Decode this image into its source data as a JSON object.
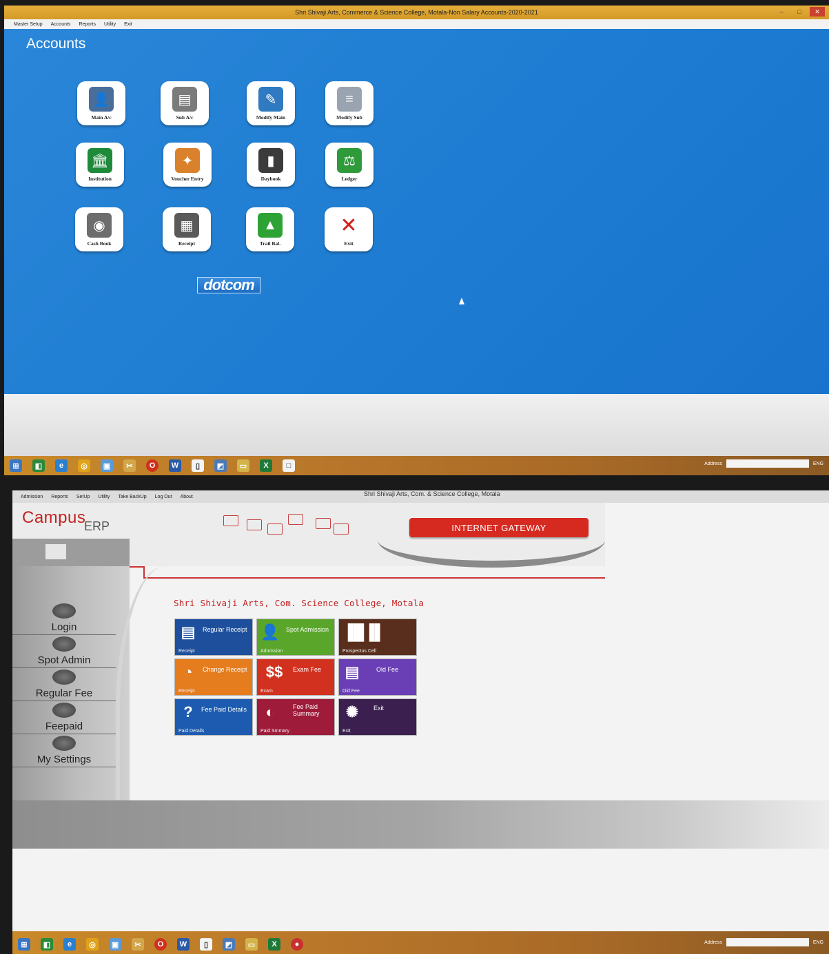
{
  "top": {
    "title": "Shri Shivaji Arts, Commerce & Science College, Motala-Non Salary Accounts-2020-2021",
    "menu": [
      "Master Setup",
      "Accounts",
      "Reports",
      "Utility",
      "Exit"
    ],
    "heading": "Accounts",
    "tiles": [
      {
        "label": "Main A/c",
        "icon": "person-folder-icon",
        "color": "#4a6e9a"
      },
      {
        "label": "Sub A/c",
        "icon": "document-stack-icon",
        "color": "#7b7b7b"
      },
      {
        "label": "Modify Main",
        "icon": "edit-document-icon",
        "color": "#2f7ac0"
      },
      {
        "label": "Modify Sub",
        "icon": "document-lines-icon",
        "color": "#9aa4b0"
      },
      {
        "label": "Institution",
        "icon": "building-icon",
        "color": "#1f8a3a"
      },
      {
        "label": "Voucher Entry",
        "icon": "cards-icon",
        "color": "#d9822b"
      },
      {
        "label": "Daybook",
        "icon": "book-icon",
        "color": "#3b3b3b"
      },
      {
        "label": "Ledger",
        "icon": "scale-icon",
        "color": "#2e9a3a"
      },
      {
        "label": "Cash Book",
        "icon": "coins-icon",
        "color": "#6d6d6d"
      },
      {
        "label": "Receipt",
        "icon": "receipt-icon",
        "color": "#5a5a5a"
      },
      {
        "label": "Trail Bal.",
        "icon": "chart-icon",
        "color": "#2fa236"
      },
      {
        "label": "Exit",
        "icon": "close-x-icon",
        "color": "#d0201a"
      }
    ],
    "brand": "dotcom"
  },
  "bottom": {
    "title": "Shri Shivaji Arts, Com. & Science College, Motala",
    "menu": [
      "Admission",
      "Reports",
      "SetUp",
      "Utility",
      "Take BackUp",
      "Log Out",
      "About"
    ],
    "logo_campus": "Campus",
    "logo_erp": "ERP",
    "gateway": "INTERNET GATEWAY",
    "sidebar": [
      {
        "label": "Login",
        "icon": "key-icon"
      },
      {
        "label": "Spot Admin",
        "icon": "person-card-icon"
      },
      {
        "label": "Regular Fee",
        "icon": "document-icon"
      },
      {
        "label": "Feepaid",
        "icon": "people-icon"
      },
      {
        "label": "My Settings",
        "icon": "tools-icon"
      }
    ],
    "college_name": "Shri Shivaji Arts, Com.  Science College, Motala",
    "tiles": [
      {
        "name": "Regular Receipt",
        "sub": "Receipt",
        "color": "#1d4f9c",
        "icon": "receipt-icon"
      },
      {
        "name": "Spot Admission",
        "sub": "Admission",
        "color": "#5aa62b",
        "icon": "person-icon"
      },
      {
        "name": "",
        "sub": "Prospectus Cell",
        "color": "#5a2e1c",
        "icon": "bar-chart-icon"
      },
      {
        "name": "Change Receipt",
        "sub": "Receipt",
        "color": "#e57c1e",
        "icon": "pie-chart-icon"
      },
      {
        "name": "Exam Fee",
        "sub": "Exam",
        "color": "#d2311f",
        "icon": "dollar-icon"
      },
      {
        "name": "Old Fee",
        "sub": "Old Fee",
        "color": "#6a3fb5",
        "icon": "document-icon"
      },
      {
        "name": "Fee Paid Details",
        "sub": "Paid Details",
        "color": "#1c5bb0",
        "icon": "question-icon"
      },
      {
        "name": "Fee Paid Summary",
        "sub": "Paid Smmary",
        "color": "#9e1b3a",
        "icon": "half-circle-icon"
      },
      {
        "name": "Exit",
        "sub": "Exit",
        "color": "#3a1f4f",
        "icon": "sun-gear-icon"
      }
    ]
  },
  "taskbar": {
    "address_label": "Address",
    "lang": "ENG"
  }
}
